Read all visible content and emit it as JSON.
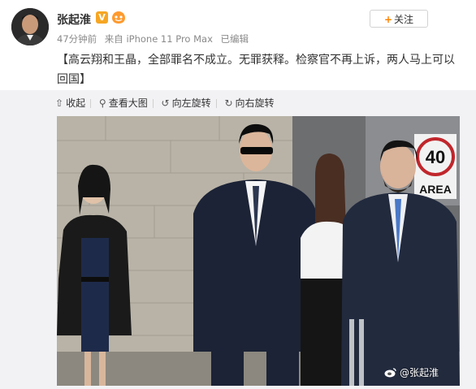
{
  "user": {
    "name": "张起淮",
    "verified_badge": "V"
  },
  "meta": {
    "time": "47分钟前",
    "source": "来自 iPhone 11 Pro Max",
    "edited": "已编辑"
  },
  "follow_button": {
    "label": "关注",
    "plus": "+"
  },
  "post": {
    "text": "【高云翔和王晶，全部罪名不成立。无罪获释。检察官不再上诉，两人马上可以回国】"
  },
  "toolbar": {
    "collapse": "收起",
    "view_large": "查看大图",
    "rotate_left": "向左旋转",
    "rotate_right": "向右旋转"
  },
  "photo": {
    "watermark": "@张起淮",
    "sign_number": "40",
    "sign_text": "AREA"
  },
  "colors": {
    "accent": "#ff8200",
    "badge": "#f6a623",
    "background": "#f2f2f5"
  },
  "icons": [
    "collapse-icon",
    "zoom-icon",
    "rotate-left-icon",
    "rotate-right-icon",
    "weibo-icon"
  ]
}
